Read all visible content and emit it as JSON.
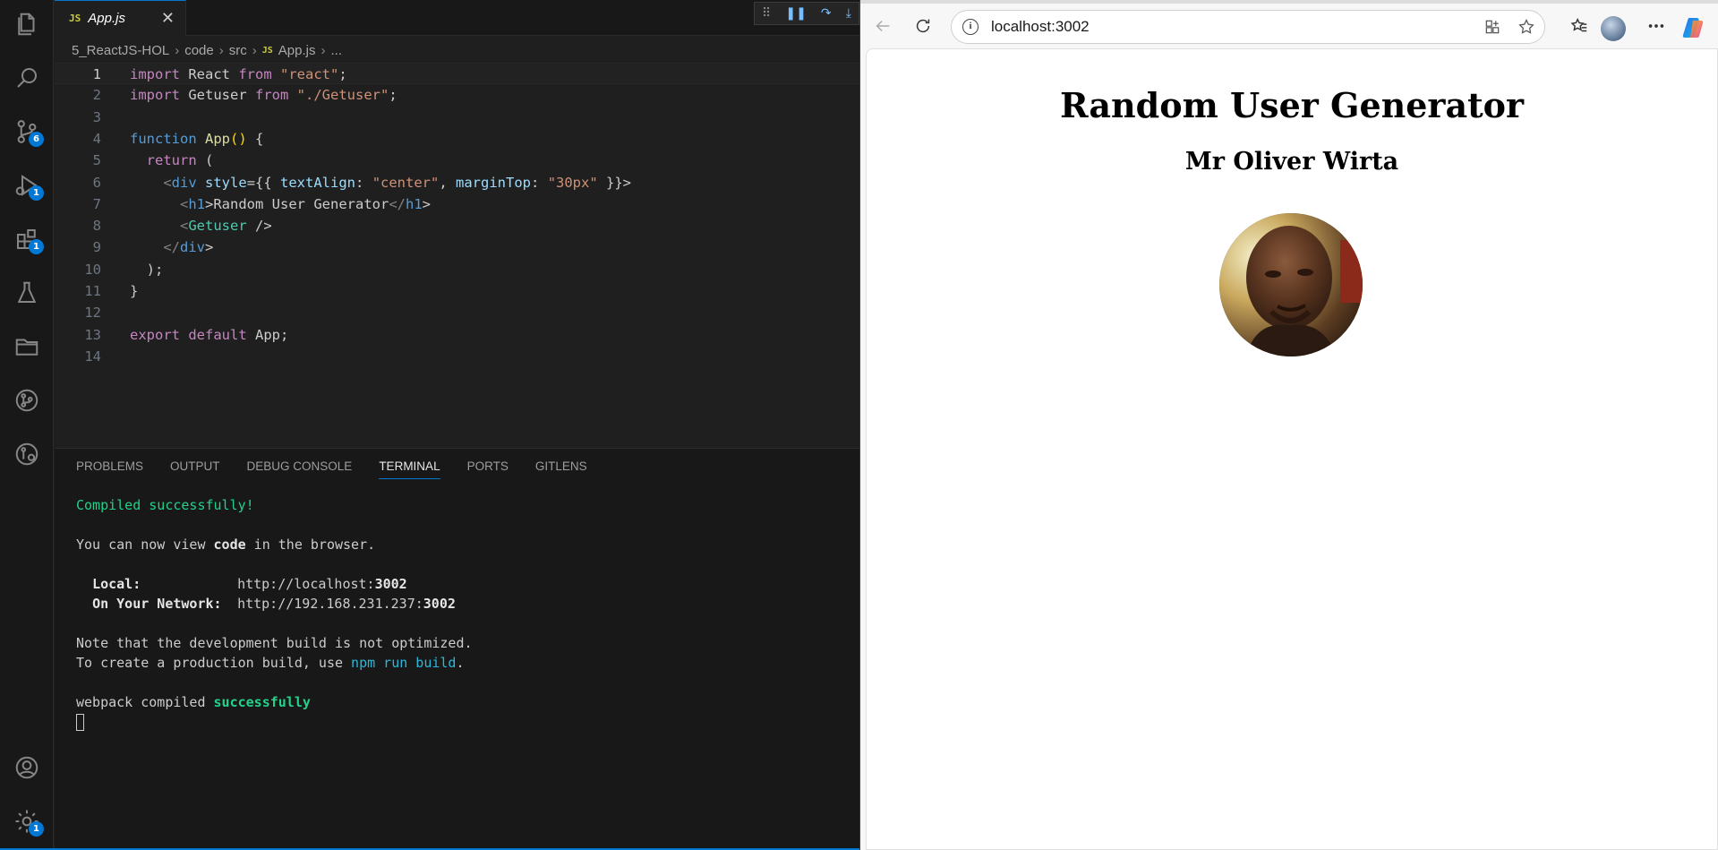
{
  "vscode": {
    "tab": {
      "icon": "JS",
      "label": "App.js",
      "close": "✕"
    },
    "breadcrumb": [
      "5_ReactJS-HOL",
      "code",
      "src",
      "App.js",
      "..."
    ],
    "breadcrumb_file_icon": "JS",
    "activity_badges": {
      "source_control": "6",
      "run_debug": "1",
      "extensions": "1",
      "settings": "1"
    },
    "editor_lines": [
      "import React from \"react\";",
      "import Getuser from \"./Getuser\";",
      "",
      "function App() {",
      "  return (",
      "    <div style={{ textAlign: \"center\", marginTop: \"30px\" }}>",
      "      <h1>Random User Generator</h1>",
      "      <Getuser />",
      "    </div>",
      "  );",
      "}",
      "",
      "export default App;",
      ""
    ],
    "panel_tabs": [
      "PROBLEMS",
      "OUTPUT",
      "DEBUG CONSOLE",
      "TERMINAL",
      "PORTS",
      "GITLENS"
    ],
    "active_panel_tab": "TERMINAL",
    "terminal": {
      "compiled": "Compiled successfully!",
      "view_prefix": "You can now view ",
      "view_app": "code",
      "view_suffix": " in the browser.",
      "local_label": "Local:",
      "local_url_prefix": "http://localhost:",
      "local_port": "3002",
      "network_label": "On Your Network:",
      "network_url_prefix": "http://192.168.231.237:",
      "network_port": "3002",
      "note1": "Note that the development build is not optimized.",
      "note2_prefix": "To create a production build, use ",
      "note2_cmd": "npm run build",
      "note2_suffix": ".",
      "webpack_prefix": "webpack compiled ",
      "webpack_status": "successfully"
    }
  },
  "browser": {
    "url": "localhost:3002",
    "page": {
      "h1": "Random User Generator",
      "h2": "Mr Oliver Wirta"
    }
  }
}
